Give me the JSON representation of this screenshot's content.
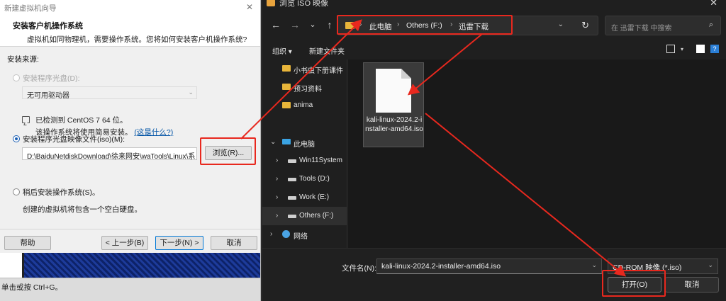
{
  "wizard": {
    "title": "新建虚拟机向导",
    "close_glyph": "✕",
    "header_title": "安装客户机操作系统",
    "header_desc": "虚拟机如同物理机，需要操作系统。您将如何安装客户机操作系统?",
    "source_label": "安装来源:",
    "option_disc": "安装程序光盘(D):",
    "disc_select_value": "无可用驱动器",
    "option_iso": "安装程序光盘映像文件(iso)(M):",
    "iso_path": "D:\\BaiduNetdiskDownload\\徐来网安\\waTools\\Linux\\系",
    "browse_button": "浏览(R)...",
    "detect_line1": "已检测到 CentOS 7 64 位。",
    "detect_line2": "该操作系统将使用简易安装。",
    "detect_link": "(这是什么?)",
    "option_later": "稍后安装操作系统(S)。",
    "later_desc": "创建的虚拟机将包含一个空白硬盘。",
    "help_button": "帮助",
    "back_button": "< 上一步(B)",
    "next_button": "下一步(N) >",
    "cancel_button": "取消",
    "statusbar_text": "单击或按 Ctrl+G。",
    "iso_selected": true
  },
  "dialog": {
    "title": "浏览 ISO 映像",
    "close_glyph": "✕",
    "nav": {
      "back": "←",
      "forward": "→",
      "recent": "⌄",
      "up": "↑"
    },
    "breadcrumb": [
      "此电脑",
      "Others (F:)",
      "迅雷下载"
    ],
    "breadcrumb_sep": "›",
    "address_dropdown_glyph": "⌄",
    "refresh_glyph": "↻",
    "search_placeholder": "在 迅雷下载 中搜索",
    "search_glyph": "⌕",
    "organize_label": "组织 ▾",
    "new_folder_label": "新建文件夹",
    "help_glyph": "?",
    "sidebar": [
      {
        "label": "小书虫下册课件",
        "icon": "folder-icon",
        "chevron": "",
        "indent": 1
      },
      {
        "label": "预习资料",
        "icon": "folder-icon",
        "chevron": "",
        "indent": 1
      },
      {
        "label": "anima",
        "icon": "folder-icon",
        "chevron": "",
        "indent": 1
      },
      {
        "label": "此电脑",
        "icon": "computer-icon",
        "chevron": "⌄",
        "indent": 0
      },
      {
        "label": "Win11System",
        "icon": "drive-icon",
        "chevron": "›",
        "indent": 1
      },
      {
        "label": "Tools (D:)",
        "icon": "drive-icon",
        "chevron": "›",
        "indent": 1
      },
      {
        "label": "Work (E:)",
        "icon": "drive-icon",
        "chevron": "›",
        "indent": 1
      },
      {
        "label": "Others (F:)",
        "icon": "drive-icon",
        "chevron": "›",
        "indent": 1,
        "selected": true
      },
      {
        "label": "网络",
        "icon": "network-icon",
        "chevron": "›",
        "indent": 0
      }
    ],
    "file": {
      "name": "kali-linux-2024.2-installer-amd64.iso"
    },
    "filename_label": "文件名(N):",
    "filename_value": "kali-linux-2024.2-installer-amd64.iso",
    "filetype_value": "CD-ROM 映像 (*.iso)",
    "dropdown_glyph": "⌄",
    "open_button": "打开(O)",
    "cancel_button": "取消"
  },
  "annotations": {
    "color": "#e8281e"
  }
}
